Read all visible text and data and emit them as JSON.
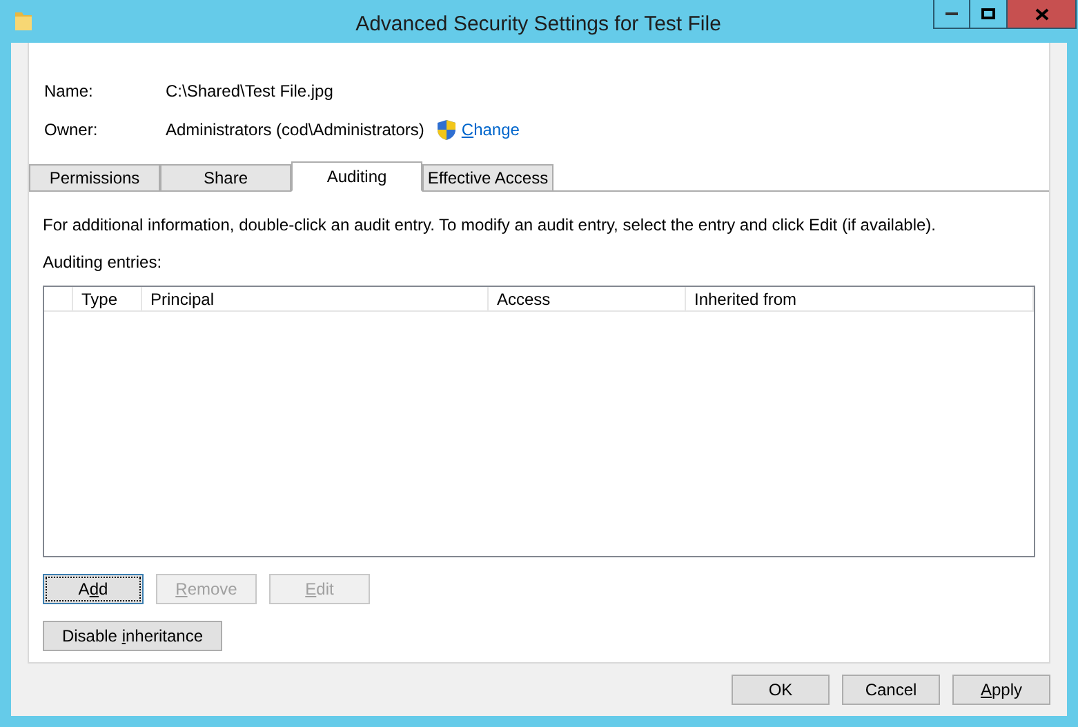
{
  "window": {
    "title": "Advanced Security Settings for Test File"
  },
  "fields": [
    {
      "label": "Name:",
      "value": "C:\\Shared\\Test File.jpg"
    },
    {
      "label": "Owner:",
      "value": "Administrators (cod\\Administrators)",
      "link": {
        "key": "C",
        "after": "hange"
      }
    }
  ],
  "tabs": [
    {
      "label": "Permissions",
      "selected": false
    },
    {
      "label": "Share",
      "selected": false
    },
    {
      "label": "Auditing",
      "selected": true
    },
    {
      "label": "Effective Access",
      "selected": false
    }
  ],
  "info": "For additional information, double-click an audit entry. To modify an audit entry, select the entry and click Edit (if available).",
  "table": {
    "label": "Auditing entries:",
    "columns": [
      "Type",
      "Principal",
      "Access",
      "Inherited from"
    ]
  },
  "entry_buttons": [
    {
      "label": {
        "before": "A",
        "key": "d",
        "after": "d"
      },
      "disabled": false,
      "focused": true
    },
    {
      "label": {
        "key": "R",
        "after": "emove"
      },
      "disabled": true,
      "focused": false
    },
    {
      "label": {
        "key": "E",
        "after": "dit"
      },
      "disabled": true,
      "focused": false
    }
  ],
  "inheritance_button": {
    "label": {
      "before": "Disable ",
      "key": "i",
      "after": "nheritance"
    }
  },
  "dialog_buttons": [
    {
      "label": {
        "after": "OK"
      }
    },
    {
      "label": {
        "after": "Cancel"
      }
    },
    {
      "label": {
        "key": "A",
        "after": "pply"
      }
    }
  ]
}
